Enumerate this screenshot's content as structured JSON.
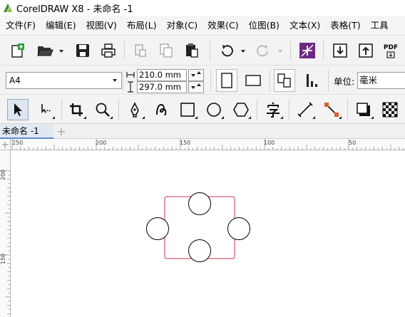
{
  "window": {
    "title": "CorelDRAW X8 - 未命名 -1"
  },
  "menu": [
    {
      "label": "文件(F)"
    },
    {
      "label": "编辑(E)"
    },
    {
      "label": "视图(V)"
    },
    {
      "label": "布局(L)"
    },
    {
      "label": "对象(C)"
    },
    {
      "label": "效果(C)"
    },
    {
      "label": "位图(B)"
    },
    {
      "label": "文本(X)"
    },
    {
      "label": "表格(T)"
    },
    {
      "label": "工具"
    }
  ],
  "standard_toolbar": {
    "pdf_label": "PDF",
    "icons": [
      "new-document-icon",
      "open-folder-icon",
      "save-icon",
      "print-icon",
      "cut-icon",
      "copy-icon",
      "paste-icon",
      "undo-icon",
      "redo-icon",
      "corel-connect-icon",
      "import-icon",
      "export-icon",
      "publish-pdf-icon"
    ]
  },
  "property_bar": {
    "page_size": "A4",
    "width": "210.0 mm",
    "height": "297.0 mm",
    "unit_label": "单位:",
    "unit_value": "毫米"
  },
  "toolbox": {
    "icons": [
      "pick-tool-icon",
      "freehand-pick-icon",
      "crop-tool-icon",
      "zoom-tool-icon",
      "pen-tool-icon",
      "artistic-media-icon",
      "rectangle-tool-icon",
      "ellipse-tool-icon",
      "polygon-tool-icon",
      "text-tool-icon",
      "dimension-tool-icon",
      "connector-tool-icon",
      "drop-shadow-icon",
      "transparency-icon"
    ]
  },
  "document_tab": {
    "label": "未命名 -1",
    "add_label": "+"
  },
  "ruler": {
    "horizontal_ticks": [
      "250",
      "200",
      "150",
      "100",
      "50"
    ],
    "vertical_ticks": [
      "200",
      "150"
    ],
    "units": "毫米"
  },
  "colors": {
    "rectangle_outline": "#d0334a",
    "circle_outline": "#000000",
    "accent": "#5b8fd0",
    "connect_icon_bg": "#6a2a82"
  }
}
